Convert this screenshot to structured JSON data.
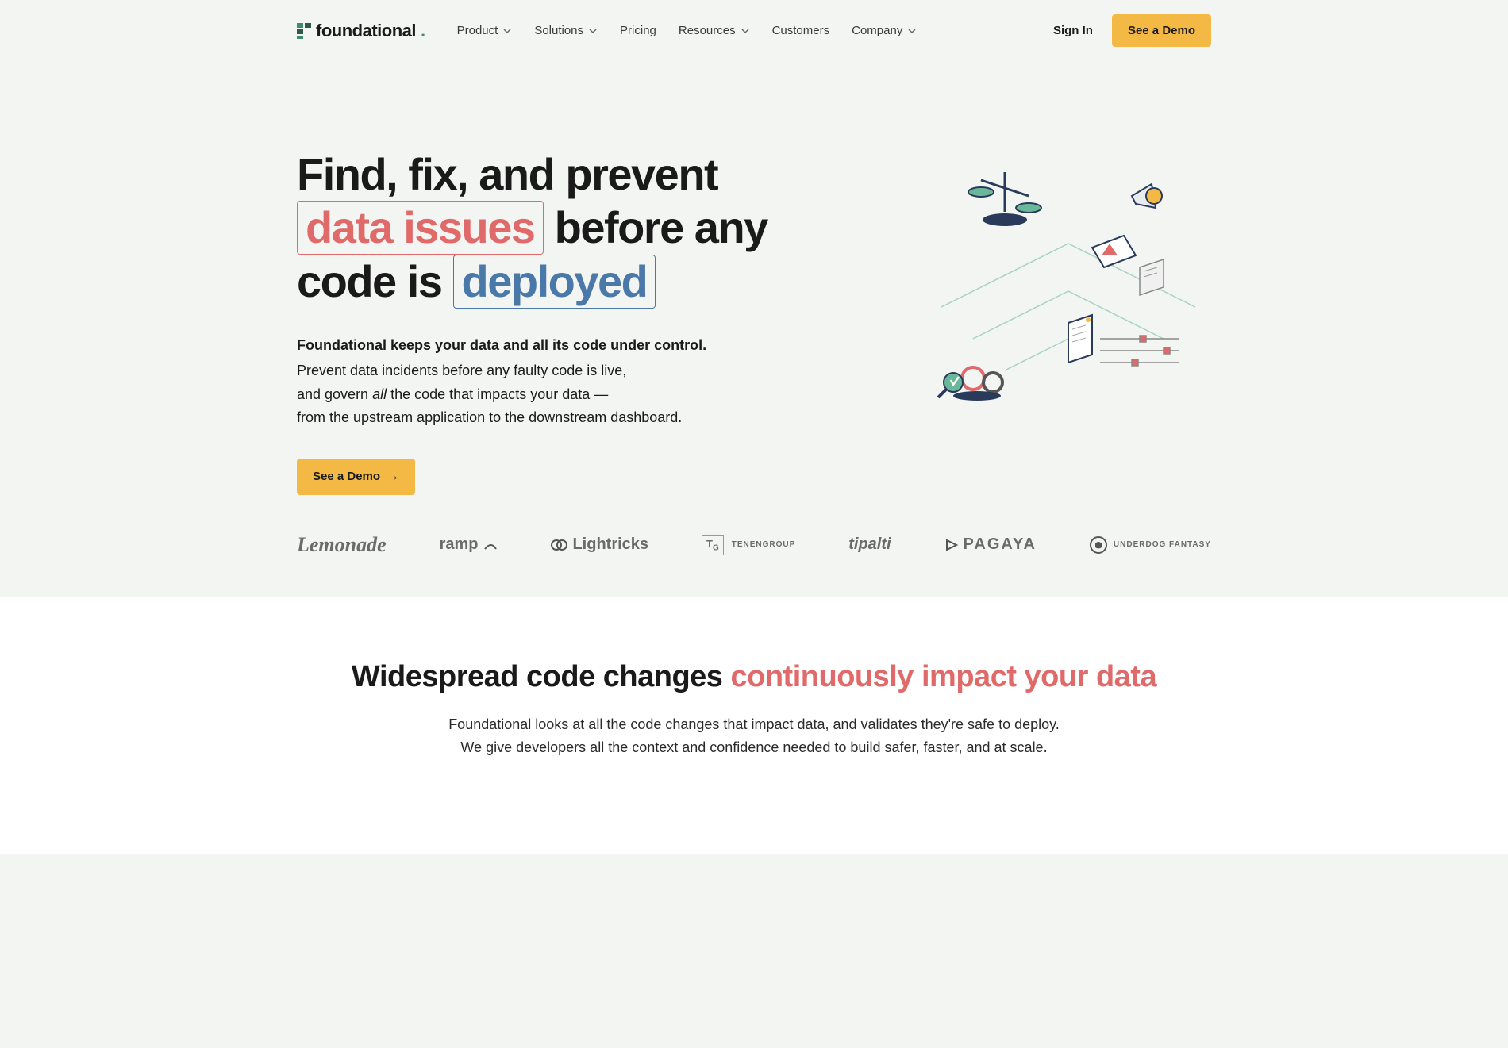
{
  "brand": {
    "name": "foundational"
  },
  "nav": {
    "items": [
      {
        "label": "Product",
        "dropdown": true
      },
      {
        "label": "Solutions",
        "dropdown": true
      },
      {
        "label": "Pricing",
        "dropdown": false
      },
      {
        "label": "Resources",
        "dropdown": true
      },
      {
        "label": "Customers",
        "dropdown": false
      },
      {
        "label": "Company",
        "dropdown": true
      }
    ],
    "sign_in": "Sign In",
    "cta": "See a Demo"
  },
  "hero": {
    "h1_part1": "Find, fix, and prevent ",
    "h1_highlight1": "data issues",
    "h1_part2": " before any code is ",
    "h1_highlight2": "deployed",
    "sub_bold": "Foundational keeps your data and all its code under control.",
    "sub_line1": "Prevent data incidents before any faulty code is live,",
    "sub_line2a": "and govern ",
    "sub_line2_em": "all",
    "sub_line2b": " the code that impacts your data —",
    "sub_line3": "from the upstream application to the downstream dashboard.",
    "cta": "See a Demo"
  },
  "clients": [
    "Lemonade",
    "ramp",
    "Lightricks",
    "TENENGROUP",
    "tipalti",
    "PAGAYA",
    "UNDERDOG FANTASY"
  ],
  "section2": {
    "h2_part1": "Widespread code changes ",
    "h2_highlight": "continuously impact your data",
    "desc_line1": "Foundational looks at all the code changes that impact data, and validates they're safe to deploy.",
    "desc_line2": "We give developers all the context and confidence needed to build safer, faster, and at scale."
  }
}
